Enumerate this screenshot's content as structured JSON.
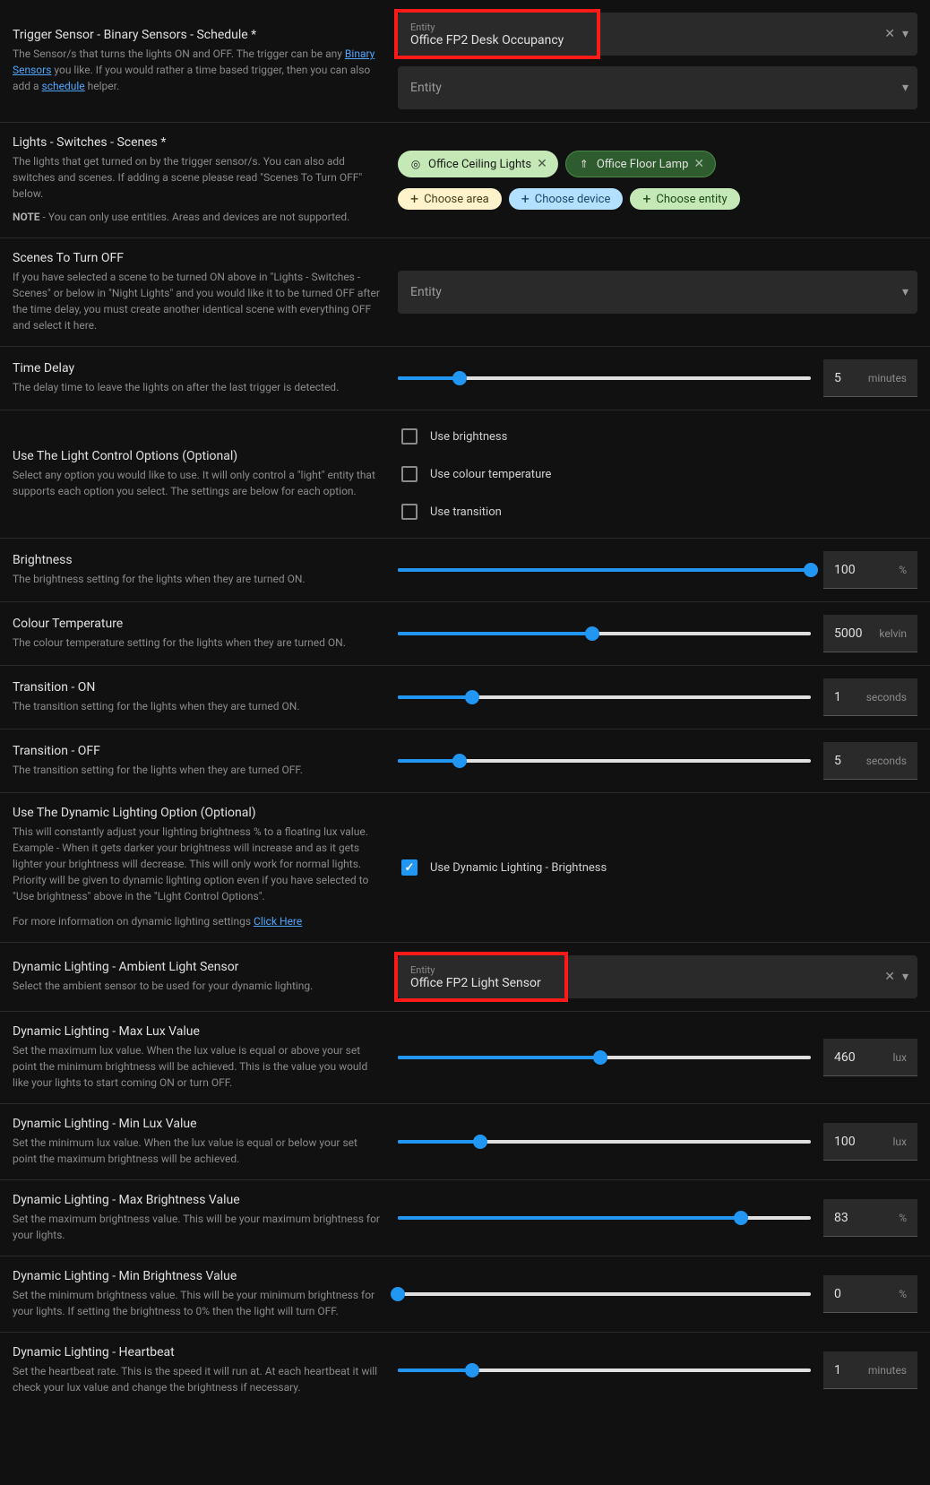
{
  "triggerSensor": {
    "title": "Trigger Sensor - Binary Sensors - Schedule *",
    "desc1": "The Sensor/s that turns the lights ON and OFF. The trigger can be any ",
    "link1": "Binary Sensors",
    "desc2": " you like. If you would rather a time based trigger, then you can also add a ",
    "link2": "schedule",
    "desc3": " helper.",
    "entityLabel": "Entity",
    "entityValue": "Office FP2 Desk Occupancy",
    "entityPlaceholder": "Entity"
  },
  "lights": {
    "title": "Lights - Switches - Scenes *",
    "desc": "The lights that get turned on by the trigger sensor/s. You can also add switches and scenes. If adding a scene please read \"Scenes To Turn OFF\" below.",
    "noteLabel": "NOTE",
    "noteText": " - You can only use entities. Areas and devices are not supported.",
    "chip1": "Office Ceiling Lights",
    "chip2": "Office Floor Lamp",
    "addArea": "Choose area",
    "addDevice": "Choose device",
    "addEntity": "Choose entity"
  },
  "scenesOff": {
    "title": "Scenes To Turn OFF",
    "desc": "If you have selected a scene to be turned ON above in \"Lights - Switches - Scenes\" or below in \"Night Lights\" and you would like it to be turned OFF after the time delay, you must create another identical scene with everything OFF and select it here.",
    "entityPlaceholder": "Entity"
  },
  "timeDelay": {
    "title": "Time Delay",
    "desc": "The delay time to leave the lights on after the last trigger is detected.",
    "value": "5",
    "unit": "minutes",
    "pct": 15
  },
  "lightControl": {
    "title": "Use The Light Control Options (Optional)",
    "desc": "Select any option you would like to use. It will only control a \"light\" entity that supports each option you select. The settings are below for each option.",
    "opt1": "Use brightness",
    "opt2": "Use colour temperature",
    "opt3": "Use transition"
  },
  "brightness": {
    "title": "Brightness",
    "desc": "The brightness setting for the lights when they are turned ON.",
    "value": "100",
    "unit": "%",
    "pct": 100
  },
  "colourTemp": {
    "title": "Colour Temperature",
    "desc": "The colour temperature setting for the lights when they are turned ON.",
    "value": "5000",
    "unit": "kelvin",
    "pct": 47
  },
  "transitionOn": {
    "title": "Transition - ON",
    "desc": "The transition setting for the lights when they are turned ON.",
    "value": "1",
    "unit": "seconds",
    "pct": 18
  },
  "transitionOff": {
    "title": "Transition - OFF",
    "desc": "The transition setting for the lights when they are turned OFF.",
    "value": "5",
    "unit": "seconds",
    "pct": 15
  },
  "dynamicLighting": {
    "title": "Use The Dynamic Lighting Option (Optional)",
    "desc": "This will constantly adjust your lighting brightness % to a floating lux value. Example - When it gets darker your brightness will increase and as it gets lighter your brightness will decrease. This will only work for normal lights. Priority will be given to dynamic lighting option even if you have selected to \"Use brightness\" above in the \"Light Control Options\".",
    "moreInfo": "For more information on dynamic lighting settings ",
    "clickHere": "Click Here",
    "checkboxLabel": "Use Dynamic Lighting - Brightness"
  },
  "ambientSensor": {
    "title": "Dynamic Lighting - Ambient Light Sensor",
    "desc": "Select the ambient sensor to be used for your dynamic lighting.",
    "entityLabel": "Entity",
    "entityValue": "Office FP2 Light Sensor"
  },
  "maxLux": {
    "title": "Dynamic Lighting - Max Lux Value",
    "desc": "Set the maximum lux value. When the lux value is equal or above your set point the minimum brightness will be achieved. This is the value you would like your lights to start coming ON or turn OFF.",
    "value": "460",
    "unit": "lux",
    "pct": 49
  },
  "minLux": {
    "title": "Dynamic Lighting - Min Lux Value",
    "desc": "Set the minimum lux value. When the lux value is equal or below your set point the maximum brightness will be achieved.",
    "value": "100",
    "unit": "lux",
    "pct": 20
  },
  "maxBright": {
    "title": "Dynamic Lighting - Max Brightness Value",
    "desc": "Set the maximum brightness value. This will be your maximum brightness for your lights.",
    "value": "83",
    "unit": "%",
    "pct": 83
  },
  "minBright": {
    "title": "Dynamic Lighting - Min Brightness Value",
    "desc": "Set the minimum brightness value. This will be your minimum brightness for your lights. If setting the brightness to 0% then the light will turn OFF.",
    "value": "0",
    "unit": "%",
    "pct": 0
  },
  "heartbeat": {
    "title": "Dynamic Lighting - Heartbeat",
    "desc": "Set the heartbeat rate. This is the speed it will run at. At each heartbeat it will check your lux value and change the brightness if necessary.",
    "value": "1",
    "unit": "minutes",
    "pct": 18
  }
}
